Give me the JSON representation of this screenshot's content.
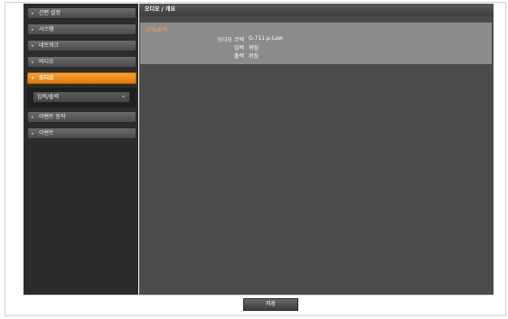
{
  "sidebar": {
    "items": [
      {
        "label": "간편 설정",
        "active": false
      },
      {
        "label": "시스템",
        "active": false
      },
      {
        "label": "네트워크",
        "active": false
      },
      {
        "label": "비디오",
        "active": false
      },
      {
        "label": "오디오",
        "active": true
      },
      {
        "label": "이벤트 동작",
        "active": false
      },
      {
        "label": "이벤트",
        "active": false
      }
    ],
    "submenu": {
      "label": "입력/출력"
    },
    "arrow_collapsed": "▸",
    "arrow_expanded": "▾",
    "sub_arrow": "▸"
  },
  "main": {
    "title": "오디오 / 개요",
    "section": {
      "title": "입력/출력",
      "rows": [
        {
          "label": "오디오 코덱",
          "value": "G.711 μ-Law"
        },
        {
          "label": "입력",
          "value": "꺼짐"
        },
        {
          "label": "출력",
          "value": "꺼짐"
        }
      ]
    }
  },
  "footer": {
    "save_label": "저장"
  },
  "colors": {
    "accent": "#f39a2b",
    "sidebar_bg": "#2c2c2c",
    "content_bg": "#4b4b4b"
  }
}
